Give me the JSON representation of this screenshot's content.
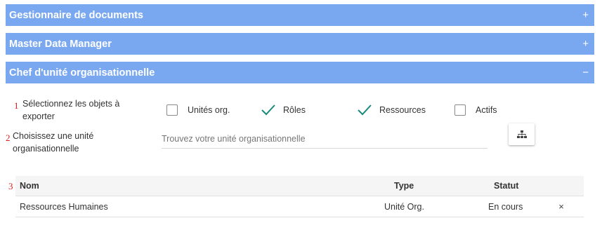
{
  "panels": [
    {
      "title": "Gestionnaire de documents",
      "toggle": "+"
    },
    {
      "title": "Master Data Manager",
      "toggle": "+"
    },
    {
      "title": "Chef d'unité organisationnelle",
      "toggle": "−"
    }
  ],
  "step_numbers": [
    "1",
    "2",
    "3"
  ],
  "export": {
    "label_line1": "Sélectionnez les objets à",
    "label_line2": "exporter",
    "options": [
      {
        "label": "Unités org.",
        "checked": false
      },
      {
        "label": "Rôles",
        "checked": true
      },
      {
        "label": "Ressources",
        "checked": true
      },
      {
        "label": "Actifs",
        "checked": false
      }
    ]
  },
  "unit": {
    "label_line1": "Choisissez une unité",
    "label_line2": "organisationnelle",
    "placeholder": "Trouvez votre unité organisationnelle",
    "value": ""
  },
  "table": {
    "headers": {
      "name": "Nom",
      "type": "Type",
      "status": "Statut"
    },
    "rows": [
      {
        "name": "Ressources Humaines",
        "type": "Unité Org.",
        "status": "En cours",
        "remove": "×"
      }
    ]
  },
  "colors": {
    "panel_header": "#7aa8f0",
    "check": "#1a8a7a",
    "step_number": "#d42020"
  }
}
